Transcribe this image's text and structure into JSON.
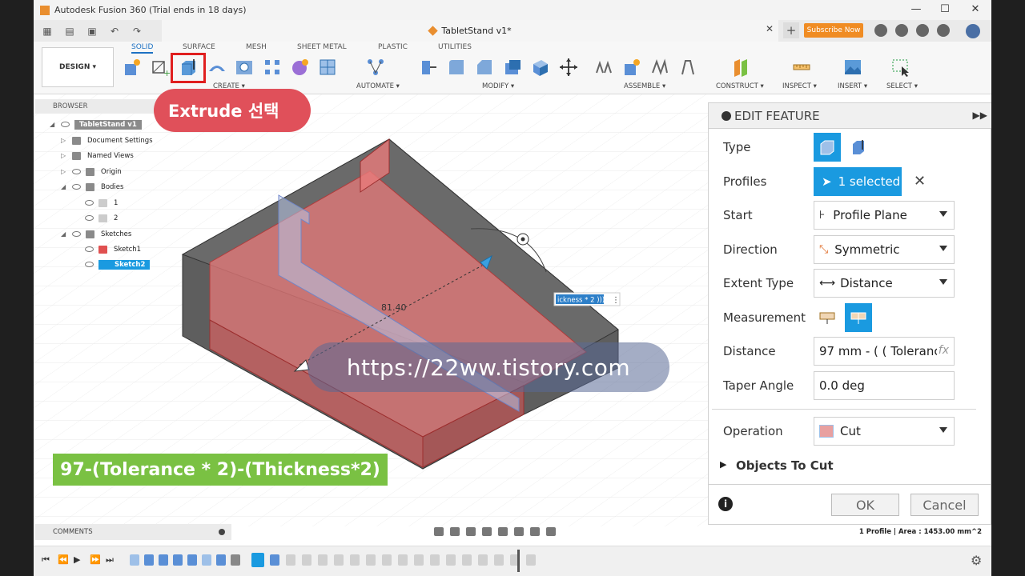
{
  "titlebar": {
    "app_title": "Autodesk Fusion 360 (Trial ends in 18 days)"
  },
  "doc_tab": {
    "name": "TabletStand v1*"
  },
  "subscribe_label": "Subscribe Now",
  "ribbon": {
    "design_label": "DESIGN ▾",
    "tabs": [
      "SOLID",
      "SURFACE",
      "MESH",
      "SHEET METAL",
      "PLASTIC",
      "UTILITIES"
    ],
    "groups": [
      "CREATE ▾",
      "AUTOMATE ▾",
      "MODIFY ▾",
      "ASSEMBLE ▾",
      "CONSTRUCT ▾",
      "INSPECT ▾",
      "INSERT ▾",
      "SELECT ▾"
    ]
  },
  "browser": {
    "header": "BROWSER",
    "items": [
      "TabletStand v1",
      "Document Settings",
      "Named Views",
      "Origin",
      "Bodies",
      "1",
      "2",
      "Sketches",
      "Sketch1",
      "Sketch2"
    ]
  },
  "annotations": {
    "extrude_label": "Extrude 선택",
    "formula_label": "97-(Tolerance * 2)-(Thickness*2)",
    "watermark": "https://22ww.tistory.com"
  },
  "viewport": {
    "dimension_text": "81.40",
    "expr_box": "ickness * 2 )))"
  },
  "edit_feature": {
    "title": "EDIT FEATURE",
    "fields": {
      "type": "Type",
      "profiles": "Profiles",
      "profiles_value": "1 selected",
      "start": "Start",
      "start_value": "Profile Plane",
      "direction": "Direction",
      "direction_value": "Symmetric",
      "extent_type": "Extent Type",
      "extent_value": "Distance",
      "measurement": "Measurement",
      "distance": "Distance",
      "distance_value": "97 mm - ( ( Tolerance",
      "taper_angle": "Taper Angle",
      "taper_value": "0.0 deg",
      "operation": "Operation",
      "operation_value": "Cut",
      "objects_to_cut": "Objects To Cut"
    },
    "ok": "OK",
    "cancel": "Cancel"
  },
  "status": "1 Profile | Area : 1453.00 mm^2",
  "comments_label": "COMMENTS",
  "colors": {
    "accent": "#1a9ae0",
    "red_box": "#e01f1f",
    "label_red": "#e0505a",
    "label_green": "#7ac143"
  }
}
